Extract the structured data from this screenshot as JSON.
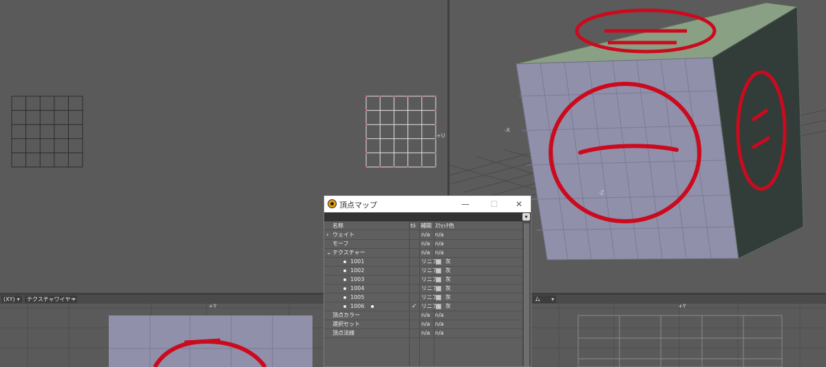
{
  "window": {
    "title": "頂点マップ"
  },
  "dialog_controls": {
    "minimize": "—",
    "maximize": "☐",
    "close": "✕",
    "dropdown": "▾"
  },
  "columns": {
    "name": "名称",
    "cell": "ｾﾙ",
    "interp": "補間",
    "swatch": "ｽｳｫｯﾁ色"
  },
  "rows": [
    {
      "name": "ウェイト",
      "indent": 0,
      "expander": "›",
      "interp": "n/a",
      "swatch": "n/a"
    },
    {
      "name": "モーフ",
      "indent": 0,
      "expander": "",
      "interp": "n/a",
      "swatch": "n/a"
    },
    {
      "name": "テクスチャー",
      "indent": 0,
      "expander": "⌄",
      "interp": "n/a",
      "swatch": "n/a"
    },
    {
      "name": "1001",
      "indent": 1,
      "bullet": true,
      "interp": "リニア",
      "swatch": "灰",
      "has_swatch": true
    },
    {
      "name": "1002",
      "indent": 1,
      "bullet": true,
      "interp": "リニア",
      "swatch": "灰",
      "has_swatch": true
    },
    {
      "name": "1003",
      "indent": 1,
      "bullet": true,
      "interp": "リニア",
      "swatch": "灰",
      "has_swatch": true
    },
    {
      "name": "1004",
      "indent": 1,
      "bullet": true,
      "interp": "リニア",
      "swatch": "灰",
      "has_swatch": true
    },
    {
      "name": "1005",
      "indent": 1,
      "bullet": true,
      "interp": "リニア",
      "swatch": "灰",
      "has_swatch": true
    },
    {
      "name": "1006",
      "indent": 1,
      "bullet": true,
      "active": true,
      "check": "✓",
      "interp": "リニア",
      "swatch": "灰",
      "has_swatch": true
    },
    {
      "name": "頂点カラー",
      "indent": 0,
      "expander": "",
      "interp": "n/a",
      "swatch": "n/a"
    },
    {
      "name": "選択セット",
      "indent": 0,
      "expander": "",
      "interp": "n/a",
      "swatch": "n/a"
    },
    {
      "name": "頂点法線",
      "indent": 0,
      "expander": "",
      "interp": "n/a",
      "swatch": "n/a"
    }
  ],
  "viewports": {
    "bottom_left": {
      "view_dropdown": "(XY)",
      "mode_dropdown": "テクスチャワイヤー"
    },
    "bottom_right": {
      "mode_dropdown": "ム"
    },
    "labels": {
      "plus_u": "+U",
      "minus_x": "-X",
      "minus_z": "-Z",
      "plus_y": "+Y"
    }
  },
  "colors": {
    "stamp_red": "#cc0a1e",
    "cube_face": "#9090aa",
    "cube_top": "#8aa084",
    "cube_side": "#323c38",
    "viewport_bg": "#5a5a5a",
    "titlebar": "#ffffff"
  },
  "icons": {
    "app": "modo-app-icon"
  }
}
